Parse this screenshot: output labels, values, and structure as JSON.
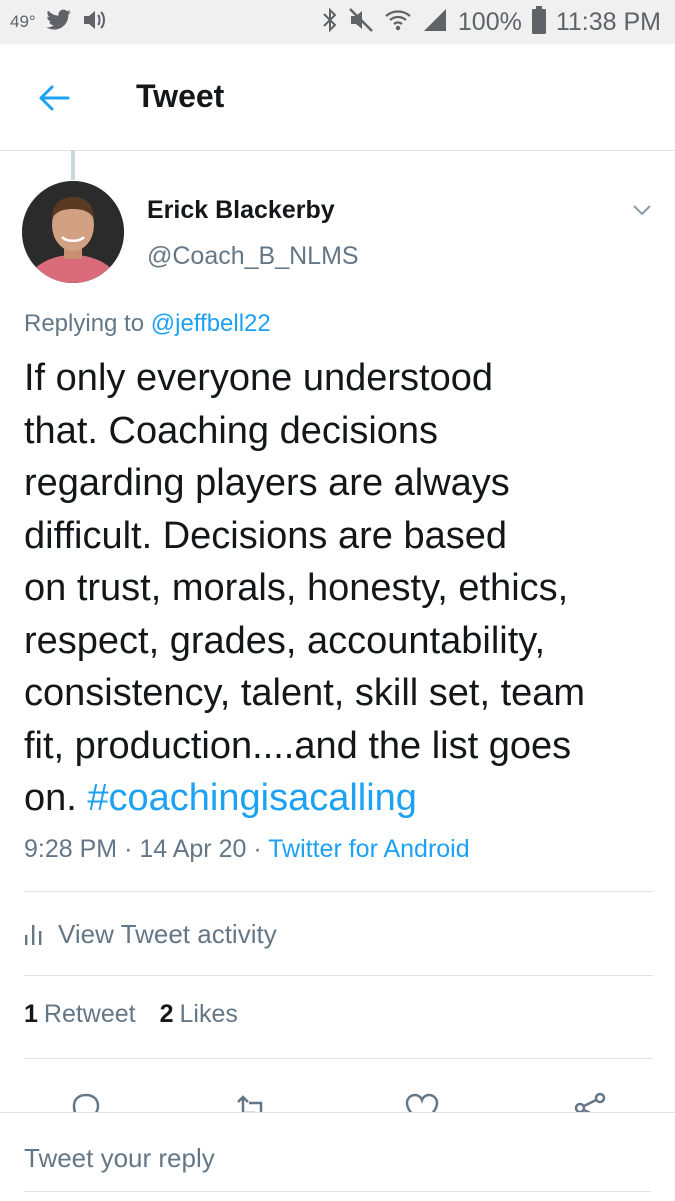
{
  "status_bar": {
    "temperature": "49°",
    "battery": "100%",
    "time": "11:38 PM"
  },
  "header": {
    "title": "Tweet"
  },
  "tweet": {
    "author_name": "Erick Blackerby",
    "author_handle": "@Coach_B_NLMS",
    "replying_prefix": "Replying to",
    "replying_to": "@jeffbell22",
    "text": "If only everyone understood\nthat.  Coaching decisions\nregarding players are always\ndifficult. Decisions are based\non trust, morals, honesty, ethics,\nrespect, grades, accountability,\nconsistency, talent, skill set, team\nfit, production....and the list goes\non.",
    "hashtag": "#coachingisacalling",
    "time": "9:28 PM",
    "date": "14 Apr 20",
    "source": "Twitter for Android",
    "activity_label": "View Tweet activity",
    "retweet_count": "1",
    "retweet_label": "Retweet",
    "like_count": "2",
    "like_label": "Likes"
  },
  "reply": {
    "placeholder": "Tweet your reply"
  },
  "icons": {
    "back": "arrow-left-icon",
    "caret": "chevron-down-icon",
    "activity": "bar-chart-icon",
    "reply": "reply-icon",
    "retweet": "retweet-icon",
    "like": "heart-icon",
    "share": "share-icon"
  },
  "colors": {
    "accent": "#1da1f2",
    "text": "#14171a",
    "secondary": "#657786"
  }
}
